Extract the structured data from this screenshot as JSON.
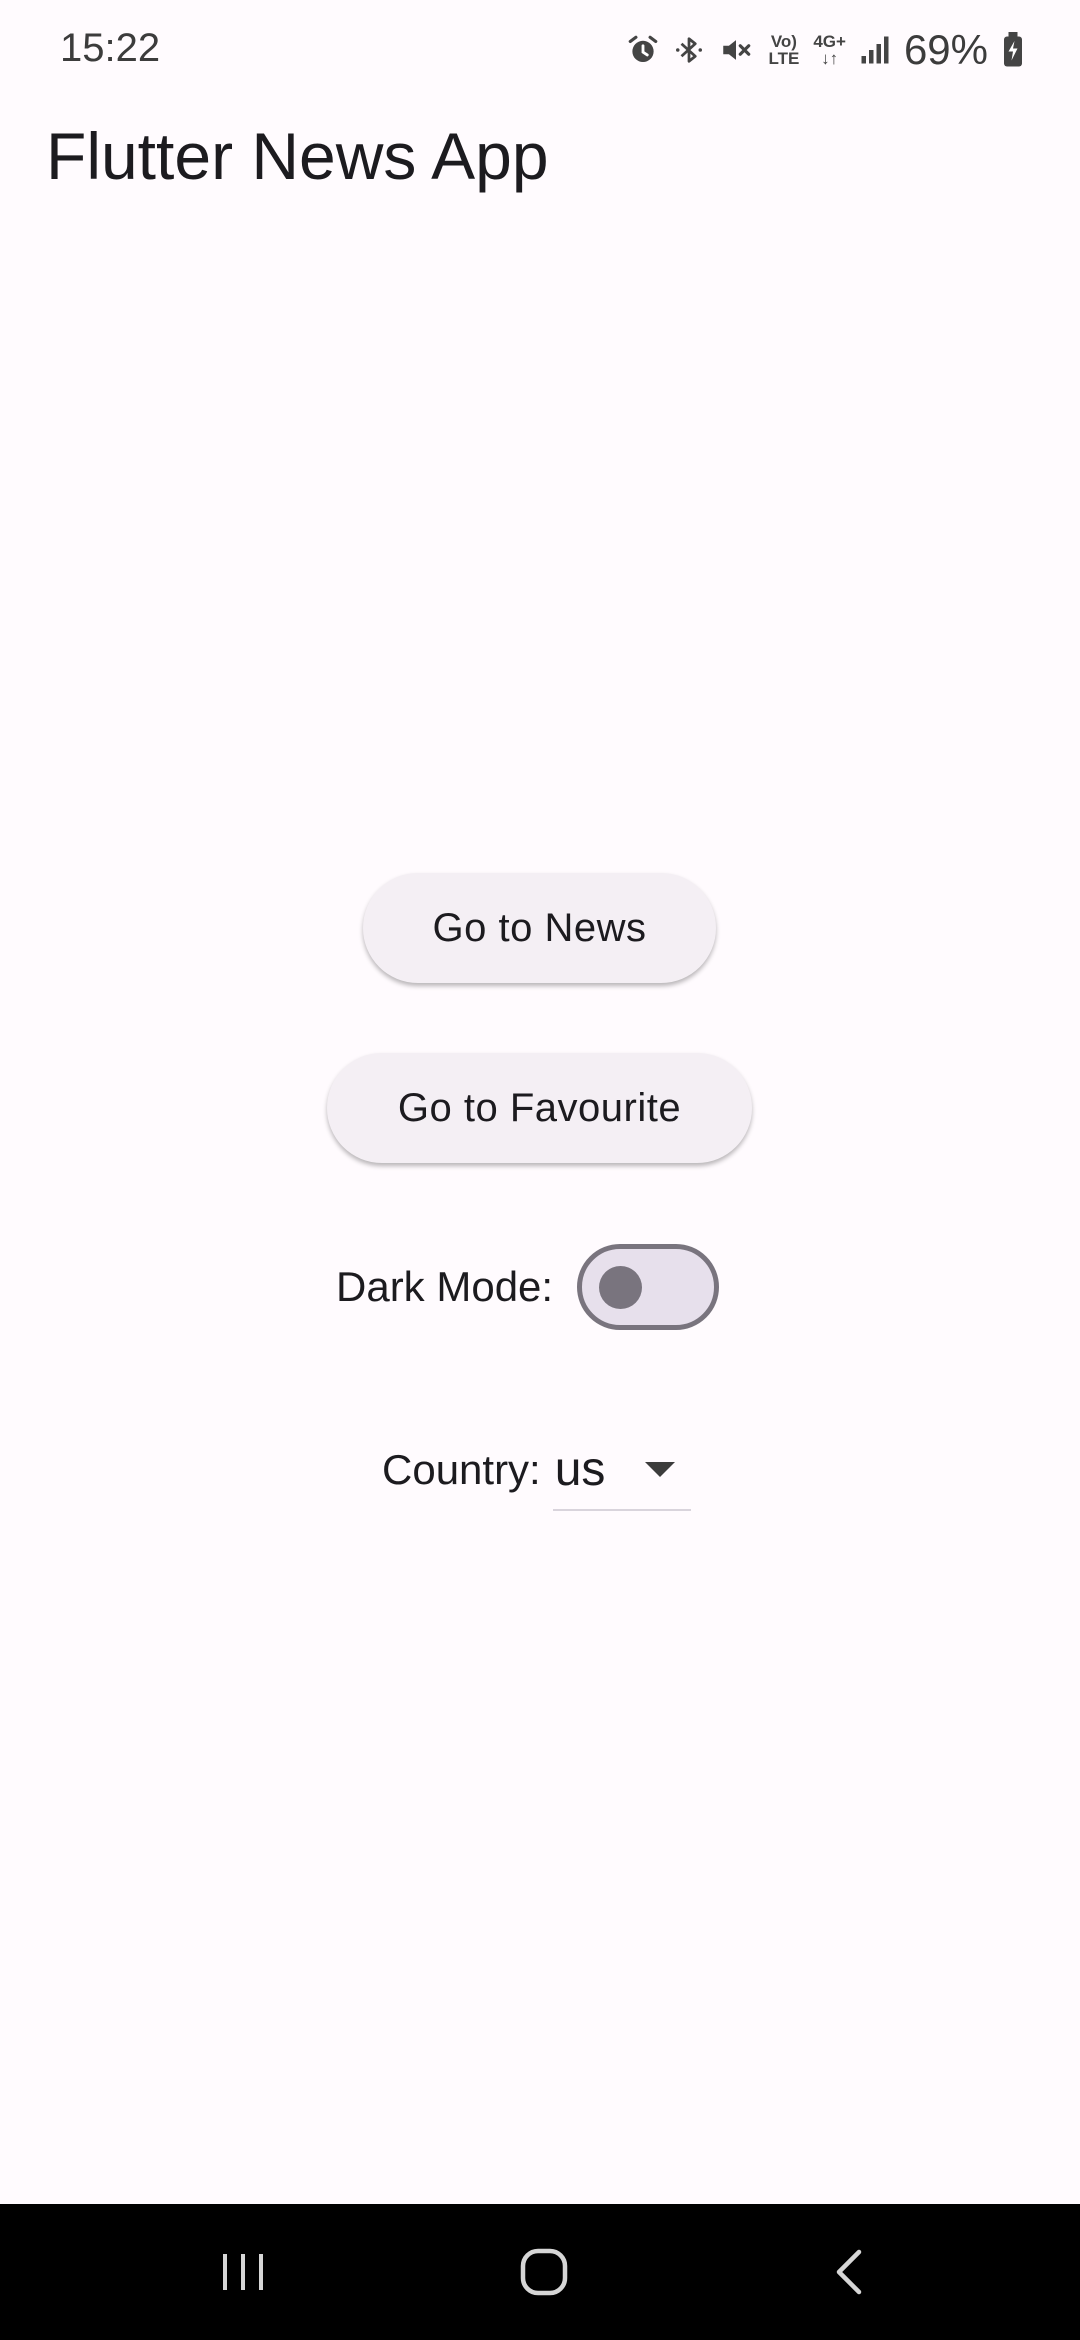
{
  "status_bar": {
    "time": "15:22",
    "icons": [
      "alarm-icon",
      "bluetooth-icon",
      "mute-icon",
      "volte-icon",
      "4g-plus-icon",
      "signal-icon",
      "battery-charging-icon"
    ],
    "volte_line1": "Vo)",
    "volte_line2": "LTE",
    "network_label": "4G+",
    "battery_percent": "69%"
  },
  "app_bar": {
    "title": "Flutter News App"
  },
  "main": {
    "news_button_label": "Go to News",
    "favourite_button_label": "Go to Favourite",
    "dark_mode": {
      "label": "Dark Mode:",
      "enabled": false
    },
    "country": {
      "label": "Country:",
      "selected": "us"
    }
  },
  "nav_bar": {
    "buttons": [
      "recent-apps-icon",
      "home-icon",
      "back-icon"
    ]
  },
  "colors": {
    "background": "#fffbfe",
    "button_bg": "#f4eff4",
    "switch_track": "#e7e0ec",
    "switch_outline": "#79747e",
    "nav_bar": "#000000"
  }
}
